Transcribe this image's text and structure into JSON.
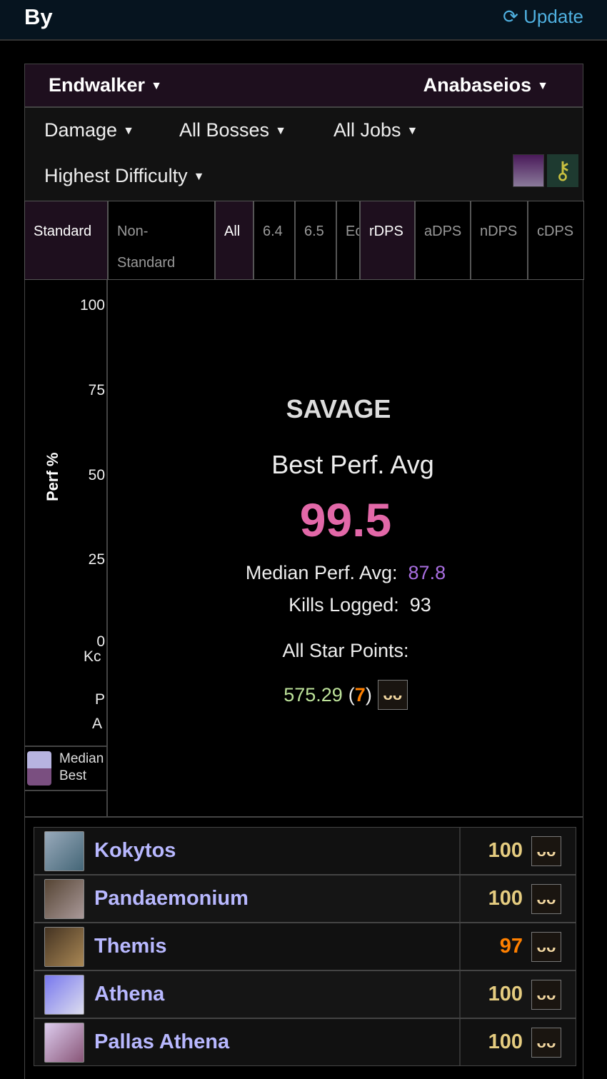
{
  "header": {
    "title": "By",
    "update_label": "Update",
    "update_icon": "refresh-icon"
  },
  "filters": {
    "expansion": "Endwalker",
    "zone": "Anabaseios",
    "metric": "Damage",
    "bosses": "All Bosses",
    "jobs": "All Jobs",
    "difficulty": "Highest Difficulty"
  },
  "tabs": {
    "partitions": [
      "Standard",
      "Non-Standard"
    ],
    "patches": [
      "All",
      "6.4",
      "6.5",
      "Ec"
    ],
    "dps": [
      "rDPS",
      "aDPS",
      "nDPS",
      "cDPS"
    ]
  },
  "chart": {
    "ylabel": "Perf %",
    "ticks": [
      "100",
      "75",
      "50",
      "25",
      "0"
    ],
    "clipped_labels": [
      "Kc",
      "P",
      "A"
    ],
    "legend": [
      "Median",
      "Best"
    ],
    "legend_colors": [
      "#b7b4e0",
      "#7a4f80"
    ]
  },
  "summary": {
    "difficulty": "SAVAGE",
    "best_label": "Best Perf. Avg",
    "best_value": "99.5",
    "median_label": "Median Perf. Avg:",
    "median_value": "87.8",
    "kills_label": "Kills Logged:",
    "kills_value": "93",
    "star_label": "All Star Points:",
    "star_points": "575.29",
    "star_rank_open": "(",
    "star_rank": "7",
    "star_rank_close": ")"
  },
  "bosses": [
    {
      "name": "Kokytos",
      "score": "100",
      "color": "#e5cc80"
    },
    {
      "name": "Pandaemonium",
      "score": "100",
      "color": "#e5cc80"
    },
    {
      "name": "Themis",
      "score": "97",
      "color": "#ff8000"
    },
    {
      "name": "Athena",
      "score": "100",
      "color": "#e5cc80"
    },
    {
      "name": "Pallas Athena",
      "score": "100",
      "color": "#e5cc80"
    }
  ]
}
